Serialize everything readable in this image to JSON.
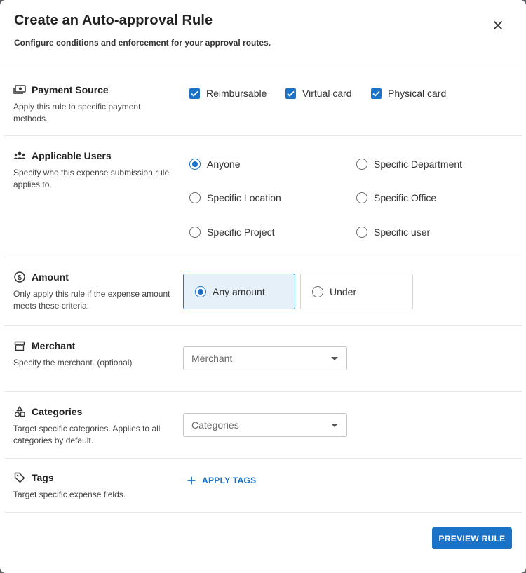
{
  "dialog": {
    "title": "Create an Auto-approval Rule",
    "subtitle": "Configure conditions and enforcement for your approval routes."
  },
  "payment_source": {
    "title": "Payment Source",
    "icon": "money-icon",
    "description": "Apply this rule to specific payment methods.",
    "options": [
      {
        "label": "Reimbursable",
        "checked": true
      },
      {
        "label": "Virtual card",
        "checked": true
      },
      {
        "label": "Physical card",
        "checked": true
      }
    ]
  },
  "applicable_users": {
    "title": "Applicable Users",
    "icon": "users-icon",
    "description": "Specify who this expense submission rule applies to.",
    "options": [
      {
        "label": "Anyone",
        "selected": true
      },
      {
        "label": "Specific Department",
        "selected": false
      },
      {
        "label": "Specific Location",
        "selected": false
      },
      {
        "label": "Specific Office",
        "selected": false
      },
      {
        "label": "Specific Project",
        "selected": false
      },
      {
        "label": "Specific user",
        "selected": false
      }
    ]
  },
  "amount": {
    "title": "Amount",
    "icon": "dollar-circle-icon",
    "description": "Only apply this rule if the expense amount meets these criteria.",
    "options": [
      {
        "label": "Any amount",
        "selected": true
      },
      {
        "label": "Under",
        "selected": false
      }
    ]
  },
  "merchant": {
    "title": "Merchant",
    "icon": "storefront-icon",
    "description": "Specify the merchant. (optional)",
    "placeholder": "Merchant"
  },
  "categories": {
    "title": "Categories",
    "icon": "shapes-icon",
    "description": "Target specific categories. Applies to all categories by default.",
    "placeholder": "Categories"
  },
  "tags": {
    "title": "Tags",
    "icon": "tag-icon",
    "description": "Target specific expense fields.",
    "apply_label": "APPLY TAGS"
  },
  "footer": {
    "preview_label": "PREVIEW RULE"
  },
  "colors": {
    "accent": "#1a73c7",
    "selected_bg": "#e6f0f9"
  }
}
